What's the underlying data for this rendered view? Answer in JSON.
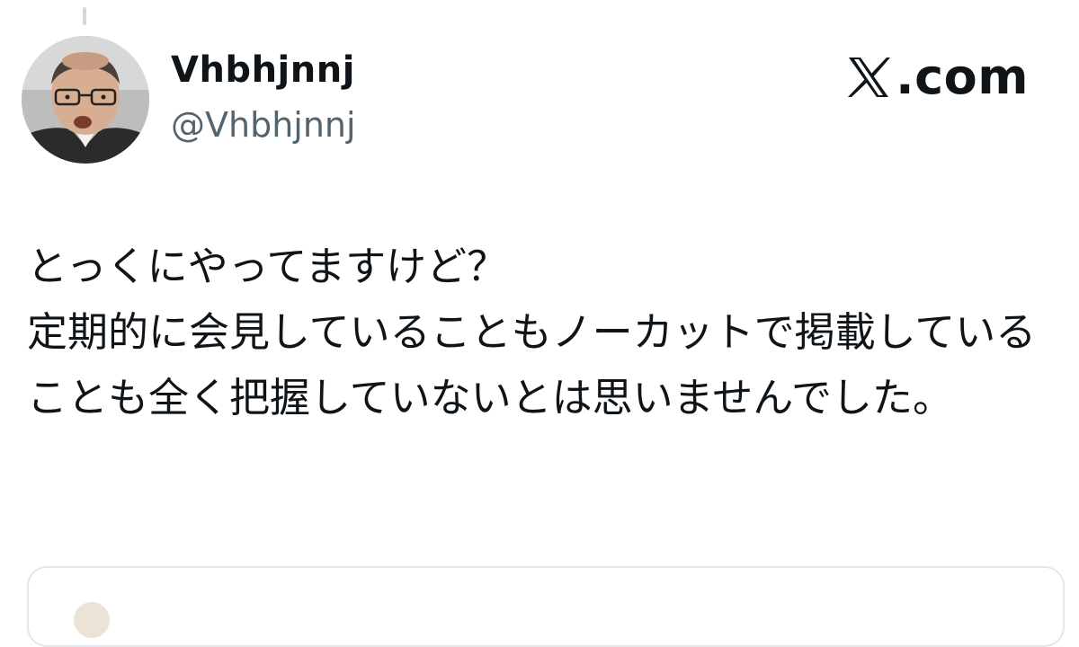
{
  "author": {
    "display_name": "Vhbhjnnj",
    "handle": "@Vhbhjnnj"
  },
  "brand": {
    "text": ".com",
    "icon": "x-logo-icon"
  },
  "tweet": {
    "text": "とっくにやってますけど？\n定期的に会見していることもノーカットで掲載していることも全く把握していないとは思いませんでした。"
  },
  "colors": {
    "text_primary": "#0f1419",
    "text_secondary": "#536471",
    "border": "#e1e8ed"
  }
}
